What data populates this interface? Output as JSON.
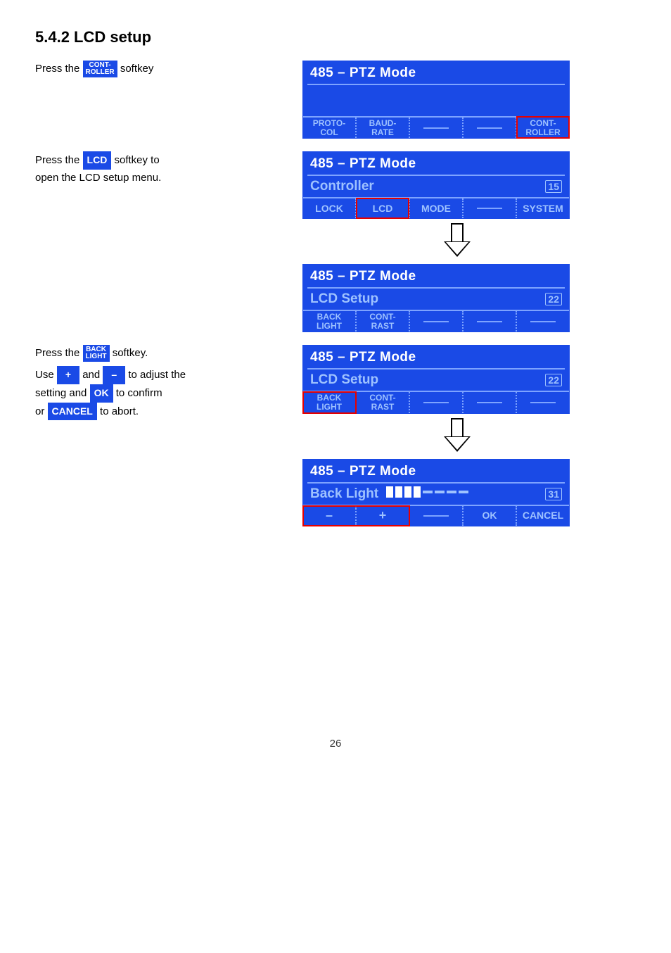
{
  "section": "5.4.2   LCD setup",
  "step1": {
    "prefix": "Press the ",
    "btn_l1": "CONT-",
    "btn_l2": "ROLLER",
    "suffix": " softkey"
  },
  "step2": {
    "t1": "Press the ",
    "btn": "LCD",
    "t2": " softkey to"
  },
  "step2b": "open the LCD setup menu.",
  "step3": {
    "t1": "Press the ",
    "btn_l1": "BACK",
    "btn_l2": "LIGHT",
    "t2": " softkey."
  },
  "step3b": {
    "t1": "Use ",
    "plus": "+",
    "t2": " and ",
    "minus": "–",
    "t3": " to adjust the"
  },
  "step3c": {
    "t1": "setting and ",
    "ok": "OK",
    "t2": " to confirm"
  },
  "step3d": {
    "t1": "or ",
    "cancel": "CANCEL",
    "t2": " to abort."
  },
  "panel1": {
    "title": "485 – PTZ Mode",
    "tabs": [
      "PROTO-\nCOL",
      "BAUD-\nRATE",
      "",
      "",
      "CONT-\nROLLER"
    ]
  },
  "panel2": {
    "title": "485 – PTZ Mode",
    "sub": "Controller",
    "num": "15",
    "tabs": [
      "LOCK",
      "LCD",
      "MODE",
      "",
      "SYSTEM"
    ]
  },
  "panel3": {
    "title": "485 – PTZ Mode",
    "sub": "LCD Setup",
    "num": "22",
    "tabs": [
      "BACK\nLIGHT",
      "CONT-\nRAST",
      "",
      "",
      ""
    ]
  },
  "panel4": {
    "title": "485 – PTZ Mode",
    "sub": "LCD Setup",
    "num": "22",
    "tabs": [
      "BACK\nLIGHT",
      "CONT-\nRAST",
      "",
      "",
      ""
    ]
  },
  "panel5": {
    "title": "485 – PTZ Mode",
    "sub": "Back Light",
    "num": "31",
    "tabs": [
      "–",
      "+",
      "",
      "OK",
      "CANCEL"
    ]
  },
  "page": "26"
}
